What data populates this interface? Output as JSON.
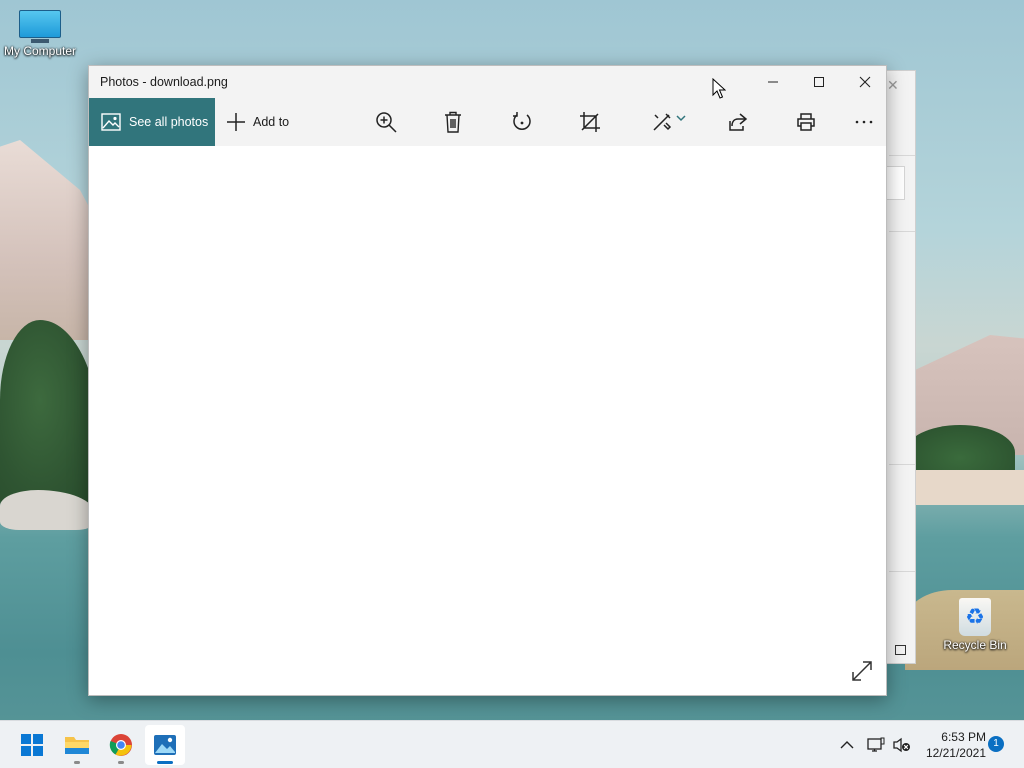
{
  "desktop": {
    "icons": [
      {
        "label": "My Computer",
        "icon": "monitor-icon"
      },
      {
        "label": "Recycle Bin",
        "icon": "recycle-bin-icon"
      }
    ]
  },
  "window": {
    "title": "Photos - download.png",
    "controls": {
      "minimize": "minimize-icon",
      "maximize": "maximize-icon",
      "close": "close-icon"
    }
  },
  "toolbar": {
    "see_all_label": "See all photos",
    "add_to_label": "Add to",
    "accent": "#31757c",
    "icons": [
      "zoom-in-icon",
      "delete-icon",
      "rotate-icon",
      "crop-icon",
      "edit-icon",
      "share-icon",
      "print-icon",
      "more-icon"
    ]
  },
  "taskbar": {
    "apps": [
      "start-icon",
      "file-explorer-icon",
      "chrome-icon",
      "photos-icon"
    ],
    "active_app": "photos-icon",
    "time": "6:53 PM",
    "date": "12/21/2021",
    "notification_count": "1"
  }
}
